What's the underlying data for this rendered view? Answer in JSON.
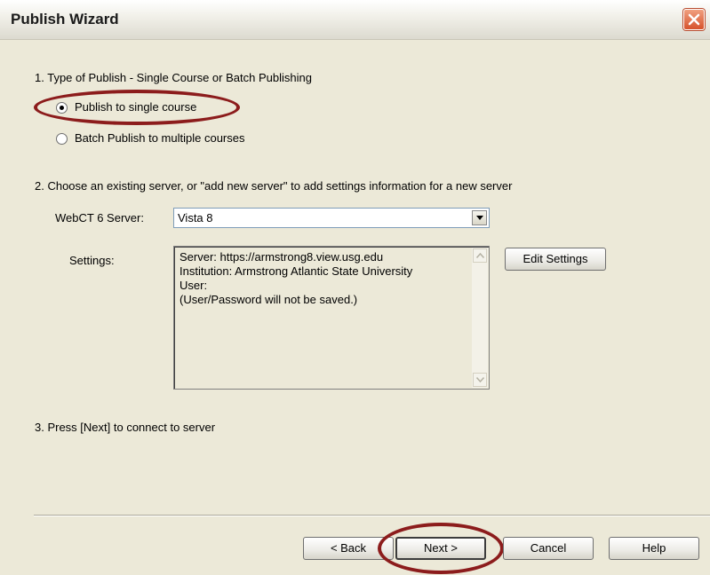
{
  "window": {
    "title": "Publish Wizard",
    "close_icon": "close-icon"
  },
  "step1": {
    "heading": "1. Type of Publish - Single Course or Batch Publishing",
    "options": [
      {
        "label": "Publish to single course",
        "checked": true
      },
      {
        "label": "Batch Publish to multiple courses",
        "checked": false
      }
    ]
  },
  "step2": {
    "heading": "2. Choose an existing server, or \"add new server\" to add settings information for a new server",
    "server_label": "WebCT 6 Server:",
    "server_value": "Vista 8",
    "settings_label": "Settings:",
    "settings_lines": [
      "Server: https://armstrong8.view.usg.edu",
      "Institution: Armstrong Atlantic State University",
      "User:",
      "(User/Password will not be saved.)"
    ],
    "edit_settings_label": "Edit Settings"
  },
  "step3": {
    "heading": "3. Press [Next] to connect to server"
  },
  "buttons": {
    "back": "< Back",
    "next": "Next >",
    "cancel": "Cancel",
    "help": "Help"
  },
  "colors": {
    "highlight": "#8c1c1c",
    "dialog_bg": "#ece9d8",
    "close_button": "#d6522c"
  }
}
